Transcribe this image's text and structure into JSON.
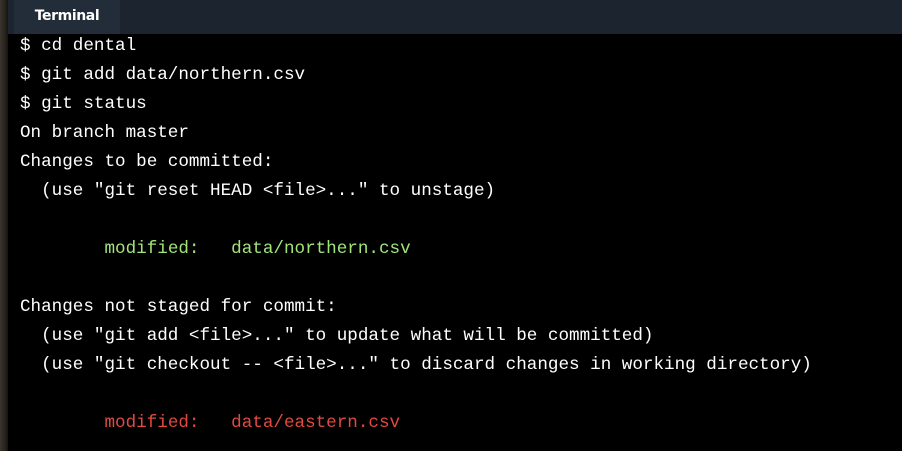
{
  "tab": {
    "label": "Terminal"
  },
  "colors": {
    "staged": "#a1e47a",
    "unstaged": "#e24a41",
    "text": "#ffffff",
    "background": "#000000"
  },
  "terminal": {
    "lines": [
      {
        "text": "$ cd dental",
        "kind": "command"
      },
      {
        "text": "$ git add data/northern.csv",
        "kind": "command"
      },
      {
        "text": "$ git status",
        "kind": "command"
      },
      {
        "text": "On branch master",
        "kind": "output"
      },
      {
        "text": "Changes to be committed:",
        "kind": "output"
      },
      {
        "text": "  (use \"git reset HEAD <file>...\" to unstage)",
        "kind": "output"
      },
      {
        "text": "",
        "kind": "output"
      },
      {
        "text": "\tmodified:   data/northern.csv",
        "kind": "staged"
      },
      {
        "text": "",
        "kind": "output"
      },
      {
        "text": "Changes not staged for commit:",
        "kind": "output"
      },
      {
        "text": "  (use \"git add <file>...\" to update what will be committed)",
        "kind": "output"
      },
      {
        "text": "  (use \"git checkout -- <file>...\" to discard changes in working directory)",
        "kind": "output"
      },
      {
        "text": "",
        "kind": "output"
      },
      {
        "text": "\tmodified:   data/eastern.csv",
        "kind": "unstaged"
      }
    ]
  }
}
